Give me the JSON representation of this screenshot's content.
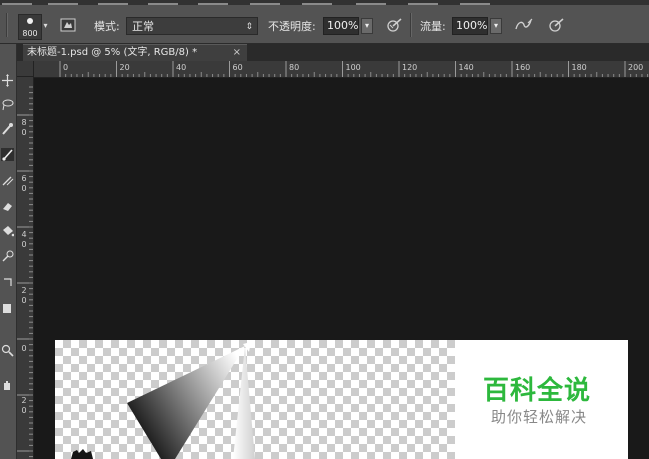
{
  "options_bar": {
    "brush_size": "800",
    "mode_label": "模式:",
    "mode_value": "正常",
    "opacity_label": "不透明度:",
    "opacity_value": "100%",
    "flow_label": "流量:",
    "flow_value": "100%"
  },
  "document_tab": {
    "title": "未标题-1.psd @ 5% (文字, RGB/8) *",
    "close_glyph": "×"
  },
  "ruler_horizontal": {
    "labels": [
      "0",
      "20",
      "40",
      "60",
      "80",
      "100",
      "120",
      "140",
      "160",
      "180",
      "200"
    ]
  },
  "ruler_vertical": {
    "labels": [
      "8",
      "0",
      "6",
      "0",
      "4",
      "0",
      "2",
      "0",
      "0",
      "2",
      "0"
    ]
  },
  "watermark": {
    "title": "百科全说",
    "subtitle": "助你轻松解决",
    "title_color": "#2db83d",
    "subtitle_color": "#888888"
  },
  "colors": {
    "pasteboard": "#191919",
    "panel": "#535353",
    "ruler": "#3a3a3a"
  }
}
